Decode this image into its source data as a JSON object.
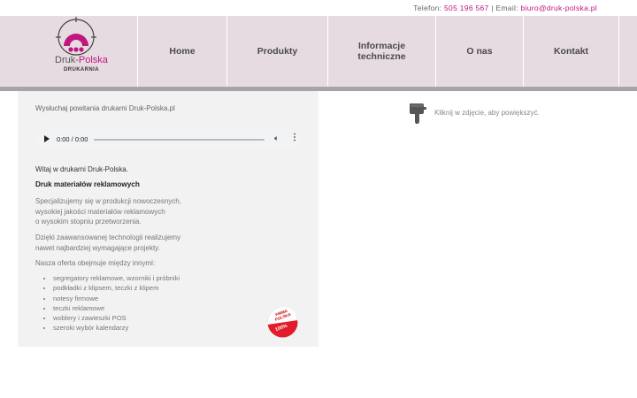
{
  "topbar": {
    "phone_label": "Telefon:",
    "phone": "505 196 567",
    "separator": "|",
    "email_label": "Email:",
    "email": "biuro@druk-polska.pl"
  },
  "logo": {
    "name_part1": "Druk",
    "name_part2": "Polska",
    "subtitle": "DRUKARNIA",
    "brand_color": "#c0177f"
  },
  "nav": {
    "items": [
      {
        "label": "Home"
      },
      {
        "label": "Produkty"
      },
      {
        "label": "Informacje techniczne"
      },
      {
        "label": "O nas"
      },
      {
        "label": "Kontakt"
      }
    ]
  },
  "content": {
    "audio_caption": "Wysłuchaj powitania drukarni Druk-Polska.pl",
    "audio_time": "0:00 / 0:00",
    "welcome": "Witaj w drukarni Druk-Polska.",
    "heading": "Druk materiałów reklamowych",
    "para1": [
      "Specjalizujemy się w produkcji nowoczesnych,",
      "wysokiej jakości materiałów reklamowych",
      "o wysokim stopniu przetworzenia."
    ],
    "para2": [
      "Dzięki zaawansowanej technologii realizujemy",
      "nawet najbardziej wymagające projekty."
    ],
    "para3": "Nasza oferta obejmuje między innymi:",
    "offer": [
      "segregatory reklamowe, wzorniki i próbniki",
      "podkładki z klipsem, teczki z klipem",
      "notesy firmowe",
      "teczki reklamowe",
      "woblery i zawieszki POS",
      "szeroki wybór kalendarzy"
    ],
    "badge": {
      "line1": "FIRMA",
      "line2": "POLSKA",
      "line3": "100%"
    }
  },
  "hint": {
    "text": "Kliknij w zdjęcie, aby powiększyć.",
    "icon": "pointing-hand-icon"
  }
}
